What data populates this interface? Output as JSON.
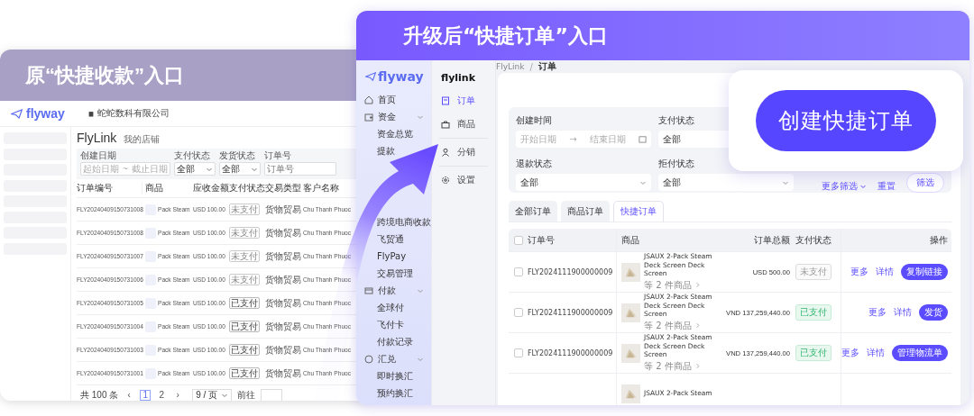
{
  "old_window": {
    "title": "原“快捷收款”入口",
    "logo": "flyway",
    "company": "蛇蛇数科有限公司",
    "page_title": "FlyLink",
    "page_subtitle": "我的店铺",
    "filters": [
      {
        "label": "创建日期",
        "kind": "daterange",
        "start": "起始日期",
        "sep": "~",
        "end": "截止日期"
      },
      {
        "label": "支付状态",
        "kind": "select",
        "value": "全部"
      },
      {
        "label": "发货状态",
        "kind": "select",
        "value": "全部"
      },
      {
        "label": "订单号",
        "kind": "text",
        "placeholder": "订单号"
      }
    ],
    "columns": [
      "订单编号",
      "商品",
      "应收金额",
      "支付状态",
      "交易类型",
      "客户名称"
    ],
    "rows": [
      {
        "id": "FLY20240409150731008",
        "product": "Pack Steam",
        "amount": "USD 100.00",
        "status": "未支付",
        "paid": false,
        "type": "货物贸易",
        "customer": "Chu Thanh Phuoc"
      },
      {
        "id": "FLY20240409150731008",
        "product": "Pack Steam",
        "amount": "USD 100.00",
        "status": "未支付",
        "paid": false,
        "type": "货物贸易",
        "customer": "Chu Thanh Phuoc"
      },
      {
        "id": "FLY20240409150731007",
        "product": "Pack Steam",
        "amount": "USD 100.00",
        "status": "未支付",
        "paid": false,
        "type": "货物贸易",
        "customer": "Chu Thanh Phuoc"
      },
      {
        "id": "FLY20240409150731006",
        "product": "Pack Steam",
        "amount": "USD 100.00",
        "status": "未支付",
        "paid": false,
        "type": "货物贸易",
        "customer": "Chu Thanh Phuoc"
      },
      {
        "id": "FLY20240409150731005",
        "product": "Pack Steam",
        "amount": "USD 100.00",
        "status": "已支付",
        "paid": true,
        "type": "货物贸易",
        "customer": "Chu Thanh Phuoc"
      },
      {
        "id": "FLY20240409150731004",
        "product": "Pack Steam",
        "amount": "USD 100.00",
        "status": "已支付",
        "paid": true,
        "type": "货物贸易",
        "customer": "Chu Thanh Phuoc"
      },
      {
        "id": "FLY20240409150731003",
        "product": "Pack Steam",
        "amount": "USD 100.00",
        "status": "已支付",
        "paid": true,
        "type": "货物贸易",
        "customer": "Chu Thanh Phuoc"
      },
      {
        "id": "FLY20240409150731001",
        "product": "Pack Steam",
        "amount": "USD 100.00",
        "status": "已支付",
        "paid": true,
        "type": "货物贸易",
        "customer": "Chu Thanh Phuoc"
      }
    ],
    "pagination": {
      "total": "共 100 条",
      "prev": "‹",
      "pages": [
        {
          "label": "1",
          "selected": true
        },
        {
          "label": "2",
          "selected": false
        }
      ],
      "next": "›",
      "page_size": "9 / 页",
      "goto": "前往"
    }
  },
  "new_window": {
    "title": "升级后“快捷订单”入口",
    "logo": "flyway",
    "nav": [
      {
        "label": "首页",
        "kind": "home"
      },
      {
        "label": "资金",
        "kind": "wallet",
        "expanded": true,
        "children": [
          {
            "label": "资金总览"
          },
          {
            "label": "提款"
          },
          {
            "label": "跨境电商收款"
          },
          {
            "label": "飞贸通"
          },
          {
            "label": "FlyPay"
          },
          {
            "label": "交易管理"
          }
        ]
      },
      {
        "label": "付款",
        "kind": "card",
        "expanded": true,
        "children": [
          {
            "label": "全球付"
          },
          {
            "label": "飞付卡"
          },
          {
            "label": "付款记录"
          }
        ]
      },
      {
        "label": "汇兑",
        "kind": "clock",
        "expanded": true,
        "children": [
          {
            "label": "即时换汇"
          },
          {
            "label": "预约换汇"
          }
        ]
      }
    ],
    "sub_logo": "flylink",
    "sub_nav": [
      {
        "label": "订单",
        "kind": "order",
        "selected": true
      },
      {
        "label": "商品",
        "kind": "bag",
        "selected": false
      },
      {
        "label": "分销",
        "kind": "person",
        "selected": false
      },
      {
        "label": "设置",
        "kind": "gear",
        "selected": false
      }
    ],
    "breadcrumb": [
      "FlyLink",
      "订单"
    ],
    "breadcrumb_separator": "/",
    "filters": [
      {
        "label": "创建时间",
        "kind": "daterange",
        "start": "开始日期",
        "sep": "→",
        "end": "结束日期"
      },
      {
        "label": "支付状态",
        "kind": "select",
        "value": "全部"
      },
      {
        "label": "退款状态",
        "kind": "select",
        "value": "全部"
      },
      {
        "label": "拒付状态",
        "kind": "select",
        "value": "全部"
      }
    ],
    "more_filters": "更多筛选",
    "reset": "重置",
    "apply": "筛选",
    "tabs": [
      {
        "label": "全部订单",
        "selected": false
      },
      {
        "label": "商品订单",
        "selected": false
      },
      {
        "label": "快捷订单",
        "selected": true
      }
    ],
    "all_checked": false,
    "columns": [
      "订单号",
      "商品",
      "订单总额",
      "支付状态",
      "操作"
    ],
    "rows": [
      {
        "checked": false,
        "id": "FLY2024111900000009",
        "product": "JSAUX 2-Pack Steam Deck Screen Deck Screen",
        "more": "等 2 件商品",
        "amount": "USD 500.00",
        "status": "未支付",
        "paid": false,
        "actions": [
          "更多",
          "详情"
        ],
        "primary": "复制链接"
      },
      {
        "checked": false,
        "id": "FLY2024111900000009",
        "product": "JSAUX 2-Pack Steam Deck Screen Deck Screen",
        "more": "等 2 件商品",
        "amount": "VND 137,259,440.00",
        "status": "已支付",
        "paid": true,
        "actions": [
          "更多",
          "详情"
        ],
        "primary": "发货"
      },
      {
        "checked": false,
        "id": "FLY2024111900000009",
        "product": "JSAUX 2-Pack Steam Deck Screen Deck Screen",
        "more": "等 2 件商品",
        "amount": "VND 137,259,440.00",
        "status": "已支付",
        "paid": true,
        "actions": [
          "更多",
          "详情"
        ],
        "primary": "管理物流单"
      },
      {
        "product": "JSAUX 2-Pack Steam"
      }
    ],
    "popup_button": "创建快捷订单"
  }
}
